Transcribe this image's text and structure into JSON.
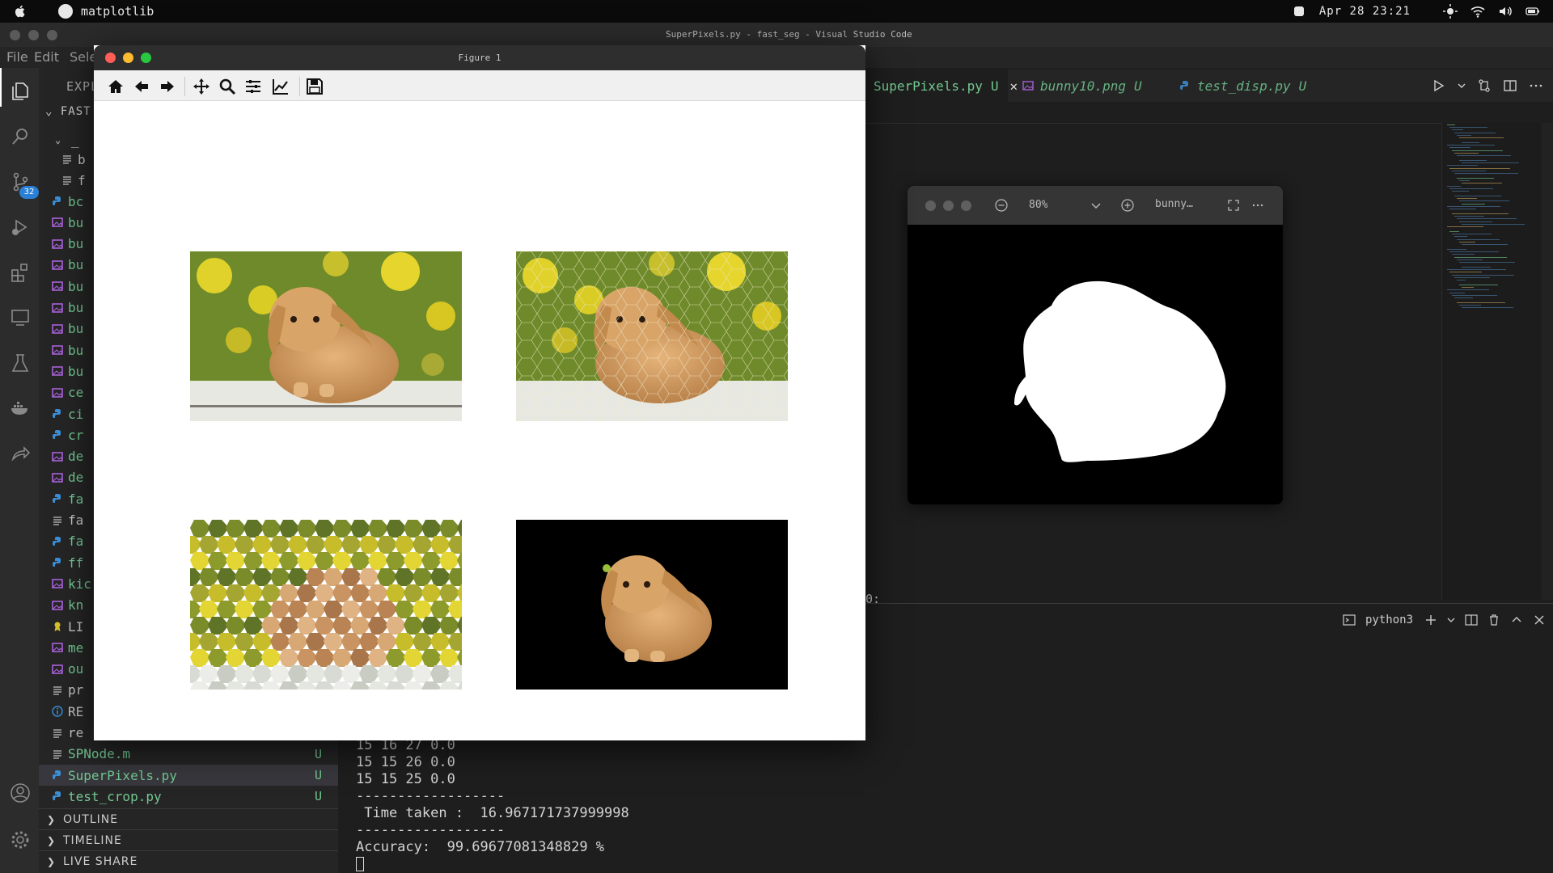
{
  "menubar": {
    "app_name": "matplotlib",
    "datetime": "Apr 28 23:21"
  },
  "vscode": {
    "window_title": "SuperPixels.py - fast_seg - Visual Studio Code",
    "menu": [
      "File",
      "Edit",
      "Sele"
    ],
    "explorer_title": "EXPL",
    "workspace_folder": "FAST",
    "scm_badge": "32",
    "files": [
      {
        "name": "_",
        "type": "folder"
      },
      {
        "name": "b",
        "type": "text"
      },
      {
        "name": "f",
        "type": "text"
      },
      {
        "name": "bc",
        "type": "python"
      },
      {
        "name": "bu",
        "type": "image"
      },
      {
        "name": "bu",
        "type": "image"
      },
      {
        "name": "bu",
        "type": "image"
      },
      {
        "name": "bu",
        "type": "image"
      },
      {
        "name": "bu",
        "type": "image"
      },
      {
        "name": "bu",
        "type": "image"
      },
      {
        "name": "bu",
        "type": "image"
      },
      {
        "name": "bu",
        "type": "image"
      },
      {
        "name": "ce",
        "type": "image"
      },
      {
        "name": "ci",
        "type": "python"
      },
      {
        "name": "cr",
        "type": "python"
      },
      {
        "name": "de",
        "type": "image"
      },
      {
        "name": "de",
        "type": "image"
      },
      {
        "name": "fa",
        "type": "python"
      },
      {
        "name": "fa",
        "type": "text"
      },
      {
        "name": "fa",
        "type": "python"
      },
      {
        "name": "ff",
        "type": "python"
      },
      {
        "name": "kic",
        "type": "image"
      },
      {
        "name": "kn",
        "type": "image"
      },
      {
        "name": "LI",
        "type": "license"
      },
      {
        "name": "me",
        "type": "image"
      },
      {
        "name": "ou",
        "type": "image"
      },
      {
        "name": "pr",
        "type": "text"
      },
      {
        "name": "RE",
        "type": "info"
      },
      {
        "name": "re",
        "type": "text"
      },
      {
        "name": "SPNode.m",
        "type": "text",
        "status": "U"
      },
      {
        "name": "SuperPixels.py",
        "type": "python",
        "status": "U",
        "selected": true
      },
      {
        "name": "test_crop.py",
        "type": "python",
        "status": "U"
      }
    ],
    "sections": [
      "OUTLINE",
      "TIMELINE",
      "LIVE SHARE"
    ],
    "tabs": [
      {
        "label": "SuperPixels.py",
        "status": "U",
        "active": true
      },
      {
        "label": "bunny10.png",
        "status": "U",
        "active": false
      },
      {
        "label": "test_disp.py",
        "status": "U",
        "active": false
      }
    ],
    "editor_snippet": "0:",
    "terminal_name": "python3",
    "terminal_lines": [
      "15 16 27 0.0",
      "15 15 26 0.0",
      "15 15 25 0.0",
      "------------------",
      " Time taken :  16.967171737999998",
      "------------------",
      "Accuracy:  99.69677081348829 %"
    ]
  },
  "preview": {
    "zoom": "80%",
    "filename": "bunny…"
  },
  "figure": {
    "title": "Figure 1",
    "toolbar": [
      "home-icon",
      "back-icon",
      "forward-icon",
      "pan-icon",
      "zoom-icon",
      "configure-subplots-icon",
      "edit-axis-icon",
      "save-icon"
    ],
    "subplots": [
      "original",
      "superpixel-boundaries",
      "superpixel-mean-colors",
      "segmented-foreground"
    ]
  },
  "colors": {
    "accent_green": "#73c991",
    "badge_blue": "#2a7fd6",
    "python_icon": "#3b8fd6",
    "image_icon": "#b267e6"
  }
}
